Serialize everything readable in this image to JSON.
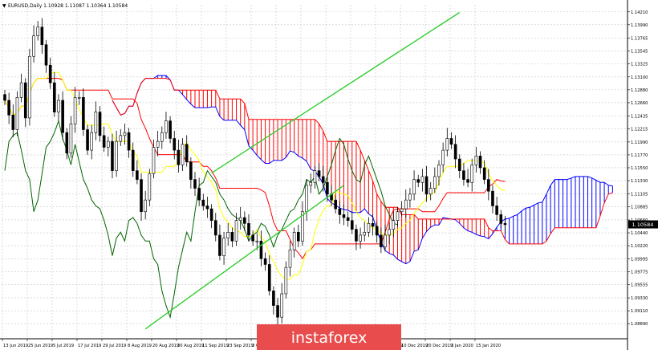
{
  "header": {
    "symbol_text": "EURUSD,Daily  1.10928 1.11087 1.10364 1.10584"
  },
  "watermark": {
    "brand": "instaforex"
  },
  "colors": {
    "candle": "#000000",
    "kijun": "#ff0000",
    "tenkan": "#ffff00",
    "chikou": "#006400",
    "cloud_bull": "#0000ff",
    "cloud_bear": "#ff0000",
    "channel": "#32cd32",
    "price_marker": "#000000",
    "watermark_bg": "#e84c4c",
    "grid": "#c8c8c8"
  },
  "chart_data": {
    "type": "candlestick",
    "title": "",
    "xlabel": "",
    "ylabel": "",
    "grid": true,
    "ylim": [
      1.0866,
      1.1433
    ],
    "y_ticks": [
      "1.14210",
      "1.13990",
      "1.13765",
      "1.13545",
      "1.13325",
      "1.13100",
      "1.12880",
      "1.12660",
      "1.12435",
      "1.12215",
      "1.11990",
      "1.11770",
      "1.11550",
      "1.11330",
      "1.11105",
      "1.10885",
      "1.10660",
      "1.10440",
      "1.10220",
      "1.09995",
      "1.09775",
      "1.09555",
      "1.09330",
      "1.09110",
      "1.08890"
    ],
    "x_ticks": [
      "13 Jun 2019",
      "25 Jun 2019",
      "5 Jul 2019",
      "17 Jul 2019",
      "29 Jul 2019",
      "8 Aug 2019",
      "20 Aug 2019",
      "30 Aug 2019",
      "11 Sep 2019",
      "23 Sep 2019",
      "3 Oct 2019",
      "15 Oct 2019",
      "25 Oct 2019",
      "6 Nov 2019",
      "18 Nov 2019",
      "28 Nov 2019",
      "10 Dec 2019",
      "20 Dec 2019",
      "3 Jan 2020",
      "15 Jan 2020"
    ],
    "current_price": {
      "label": "1.10584",
      "value": 1.10584
    },
    "closes": [
      1.127,
      1.1245,
      1.122,
      1.1275,
      1.13,
      1.124,
      1.1345,
      1.138,
      1.1395,
      1.1365,
      1.133,
      1.13,
      1.125,
      1.127,
      1.1215,
      1.118,
      1.123,
      1.1275,
      1.1275,
      1.122,
      1.1185,
      1.1215,
      1.125,
      1.121,
      1.119,
      1.12,
      1.115,
      1.12,
      1.121,
      1.1215,
      1.1185,
      1.115,
      1.1135,
      1.108,
      1.11,
      1.1145,
      1.119,
      1.12,
      1.1215,
      1.1235,
      1.1205,
      1.1185,
      1.116,
      1.1195,
      1.1165,
      1.1135,
      1.112,
      1.11,
      1.109,
      1.1085,
      1.1065,
      1.104,
      1.1005,
      1.1035,
      1.1045,
      1.103,
      1.1065,
      1.107,
      1.106,
      1.104,
      1.103,
      1.103,
      1.1,
      1.099,
      1.0945,
      1.092,
      1.09,
      1.094,
      1.0985,
      1.1015,
      1.1045,
      1.103,
      1.108,
      1.1125,
      1.113,
      1.115,
      1.114,
      1.113,
      1.111,
      1.11,
      1.1085,
      1.1075,
      1.107,
      1.1065,
      1.105,
      1.103,
      1.104,
      1.1045,
      1.106,
      1.1055,
      1.104,
      1.102,
      1.104,
      1.105,
      1.1065,
      1.108,
      1.1085,
      1.11,
      1.111,
      1.1135,
      1.113,
      1.114,
      1.111,
      1.112,
      1.114,
      1.116,
      1.1185,
      1.1205,
      1.1195,
      1.117,
      1.115,
      1.1135,
      1.113,
      1.116,
      1.1175,
      1.1155,
      1.1135,
      1.1115,
      1.109,
      1.1075,
      1.106,
      1.1058
    ],
    "series": [
      {
        "name": "Tenkan-sen"
      },
      {
        "name": "Kijun-sen"
      },
      {
        "name": "Senkou Span A"
      },
      {
        "name": "Senkou Span B"
      },
      {
        "name": "Chikou Span"
      }
    ],
    "channel_lines": [
      {
        "from": [
          34,
          1.088
        ],
        "to": [
          82,
          1.1125
        ]
      },
      {
        "from": [
          50,
          1.1146
        ],
        "to": [
          110,
          1.142
        ]
      }
    ]
  }
}
